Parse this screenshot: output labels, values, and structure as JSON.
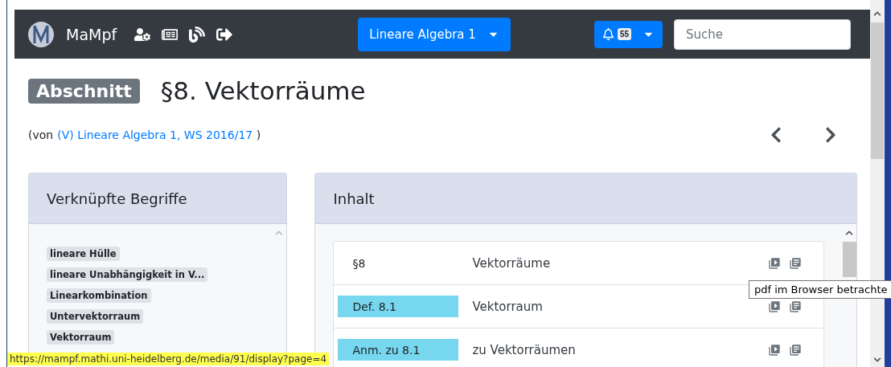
{
  "navbar": {
    "brand": "MaMpf",
    "course_button": "Lineare Algebra 1",
    "notification_count": "55",
    "search": {
      "placeholder": "Suche"
    }
  },
  "header": {
    "badge": "Abschnitt",
    "title": "§8. Vektorräume",
    "source_prefix": "(von",
    "source_link": "(V) Lineare Algebra 1, WS 2016/17",
    "source_suffix": ")"
  },
  "tags_card": {
    "title": "Verknüpfte Begriffe",
    "tags": [
      "lineare Hülle",
      "lineare Unabhängigkeit in V...",
      "Linearkombination",
      "Untervektorraum",
      "Vektorraum"
    ]
  },
  "content_card": {
    "title": "Inhalt",
    "rows": [
      {
        "number": "§8",
        "title": "Vektorräume",
        "highlighted": false
      },
      {
        "number": "Def. 8.1",
        "title": "Vektorraum",
        "highlighted": true
      },
      {
        "number": "Anm. zu 8.1",
        "title": "zu Vektorräumen",
        "highlighted": true
      }
    ]
  },
  "tooltip": "pdf im Browser betrachte",
  "status_bar": "https://mampf.mathi.uni-heidelberg.de/media/91/display?page=4"
}
